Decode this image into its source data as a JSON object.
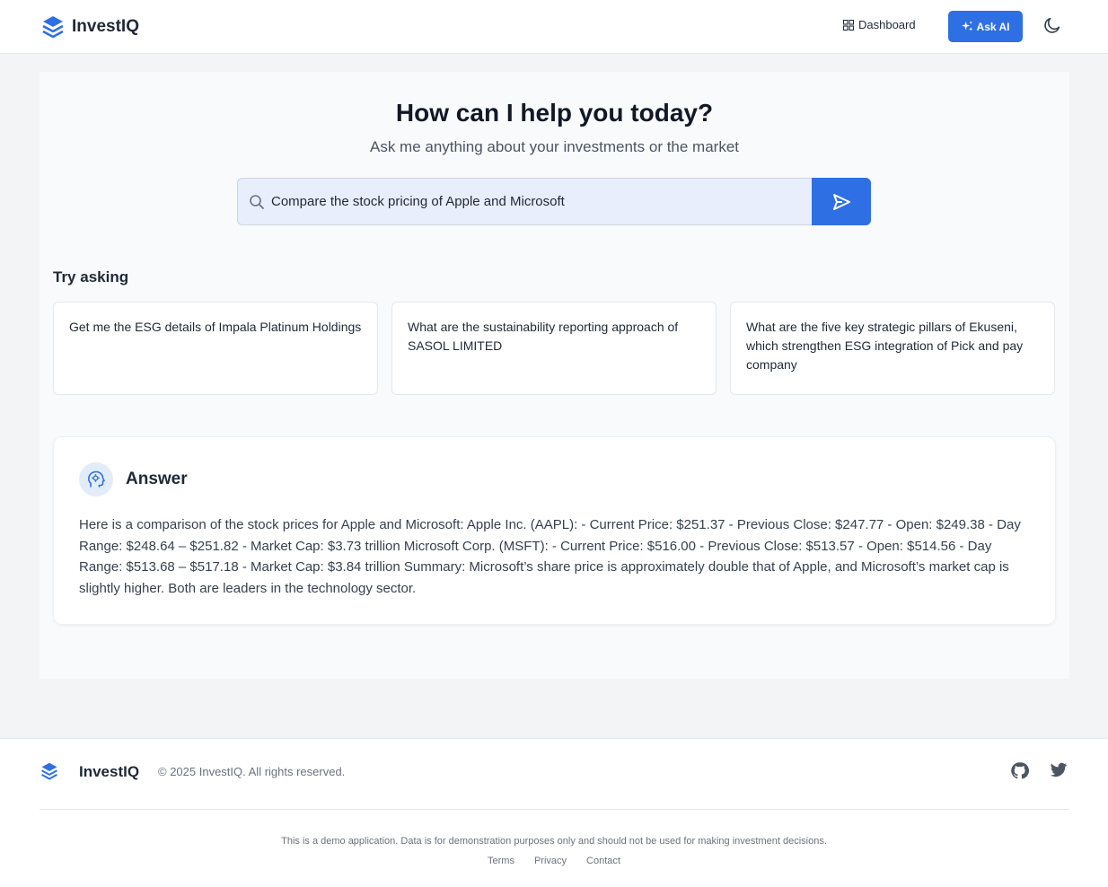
{
  "header": {
    "brand": "InvestIQ",
    "nav_dashboard": "Dashboard",
    "ask_ai": "Ask AI",
    "icons": {
      "logo": "layers-icon",
      "dashboard": "grid-icon",
      "ask_ai": "sparkle-icon",
      "theme": "moon-icon"
    }
  },
  "hero": {
    "title": "How can I help you today?",
    "subtitle": "Ask me anything about your investments or the market"
  },
  "search": {
    "value": "Compare the stock pricing of Apple and Microsoft",
    "icon": "search-icon",
    "send_icon": "send-icon"
  },
  "suggestions": {
    "label": "Try asking",
    "items": [
      "Get me the ESG details of Impala Platinum Holdings",
      "What are the sustainability reporting approach of SASOL LIMITED",
      "What are the five key strategic pillars of Ekuseni, which strengthen ESG integration of Pick and pay company"
    ]
  },
  "answer": {
    "title": "Answer",
    "icon": "brain-head-icon",
    "text": "Here is a comparison of the stock prices for Apple and Microsoft: Apple Inc. (AAPL): - Current Price: $251.37 - Previous Close: $247.77 - Open: $249.38 - Day Range: $248.64 – $251.82 - Market Cap: $3.73 trillion Microsoft Corp. (MSFT): - Current Price: $516.00 - Previous Close: $513.57 - Open: $514.56 - Day Range: $513.68 – $517.18 - Market Cap: $3.84 trillion Summary: Microsoft’s share price is approximately double that of Apple, and Microsoft’s market cap is slightly higher. Both are leaders in the technology sector."
  },
  "footer": {
    "brand": "InvestIQ",
    "copyright": "© 2025 InvestIQ. All rights reserved.",
    "disclaimer": "This is a demo application. Data is for demonstration purposes only and should not be used for making investment decisions.",
    "links": [
      "Terms",
      "Privacy",
      "Contact"
    ],
    "icons": {
      "github": "github-icon",
      "twitter": "twitter-icon"
    }
  },
  "colors": {
    "accent": "#2f6fe4",
    "page_bg": "#f3f4f6",
    "search_bg": "#e8eefb"
  }
}
